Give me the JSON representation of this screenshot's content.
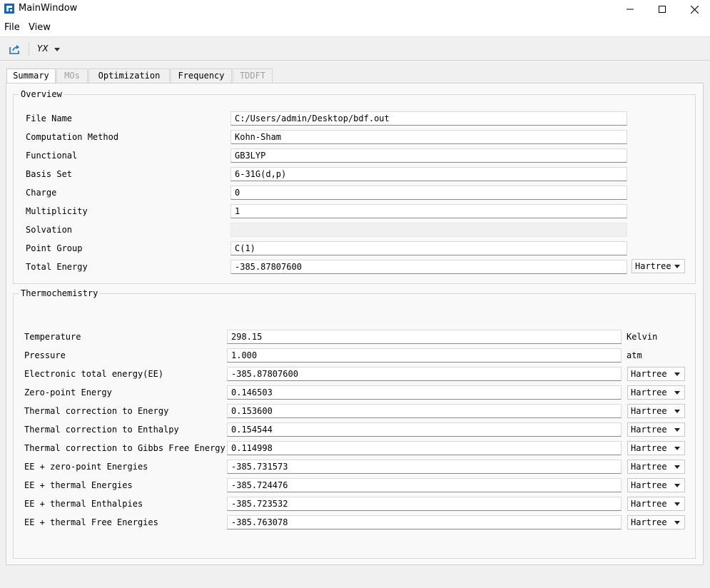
{
  "window": {
    "title": "MainWindow"
  },
  "menu": [
    "File",
    "View"
  ],
  "toolbar": {
    "export_icon": "export-icon",
    "axis_selector": "YX"
  },
  "tabs": [
    {
      "label": "Summary",
      "state": "active"
    },
    {
      "label": "MOs",
      "state": "disabled"
    },
    {
      "label": "Optimization",
      "state": "normal"
    },
    {
      "label": "Frequency",
      "state": "normal"
    },
    {
      "label": "TDDFT",
      "state": "disabled"
    }
  ],
  "overview": {
    "title": "Overview",
    "rows": [
      {
        "label": "File Name",
        "value": "C:/Users/admin/Desktop/bdf.out"
      },
      {
        "label": "Computation Method",
        "value": "Kohn-Sham"
      },
      {
        "label": "Functional",
        "value": "GB3LYP"
      },
      {
        "label": "Basis Set",
        "value": "6-31G(d,p)"
      },
      {
        "label": "Charge",
        "value": "0"
      },
      {
        "label": "Multiplicity",
        "value": "1"
      },
      {
        "label": "Solvation",
        "value": ""
      },
      {
        "label": "Point Group",
        "value": "C(1)"
      },
      {
        "label": "Total Energy",
        "value": "-385.87807600",
        "unit": "Hartree"
      }
    ]
  },
  "thermo": {
    "title": "Thermochemistry",
    "rows": [
      {
        "label": "Temperature",
        "value": "298.15",
        "unit": "Kelvin"
      },
      {
        "label": "Pressure",
        "value": "1.000",
        "unit": "atm"
      },
      {
        "label": "Electronic total energy(EE)",
        "value": "-385.87807600",
        "unit": "Hartree"
      },
      {
        "label": "Zero-point Energy",
        "value": "0.146503",
        "unit": "Hartree"
      },
      {
        "label": "Thermal correction to Energy",
        "value": "0.153600",
        "unit": "Hartree"
      },
      {
        "label": "Thermal correction to Enthalpy",
        "value": "0.154544",
        "unit": "Hartree"
      },
      {
        "label": "Thermal correction to Gibbs Free Energy",
        "value": "0.114998",
        "unit": "Hartree"
      },
      {
        "label": "EE + zero-point Energies",
        "value": "-385.731573",
        "unit": "Hartree"
      },
      {
        "label": "EE + thermal Energies",
        "value": "-385.724476",
        "unit": "Hartree"
      },
      {
        "label": "EE + thermal Enthalpies",
        "value": "-385.723532",
        "unit": "Hartree"
      },
      {
        "label": "EE + thermal Free Energies",
        "value": "-385.763078",
        "unit": "Hartree"
      }
    ]
  }
}
